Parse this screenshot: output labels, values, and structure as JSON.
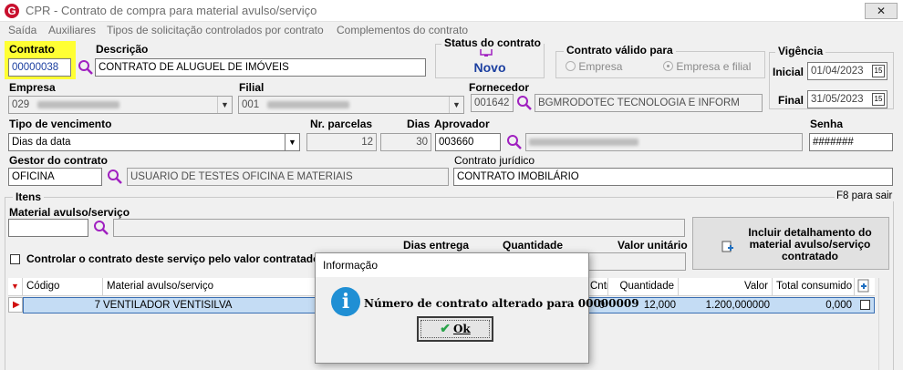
{
  "window": {
    "title": "CPR - Contrato de compra para material avulso/serviço",
    "close_label": "✕"
  },
  "menu": {
    "items": [
      {
        "label": "Saída",
        "underline": "S"
      },
      {
        "label": "Auxiliares",
        "underline": "A"
      },
      {
        "label": "Tipos de solicitação controlados por contrato",
        "underline": "T"
      },
      {
        "label": "Complementos do contrato",
        "underline": "C"
      }
    ]
  },
  "form": {
    "contrato_label": "Contrato",
    "contrato_value": "00000038",
    "descricao_label": "Descrição",
    "descricao_value": "CONTRATO DE ALUGUEL DE IMÓVEIS",
    "status_title": "Status do contrato",
    "status_value": "Novo",
    "valido_title": "Contrato válido para",
    "valido_empresa": "Empresa",
    "valido_filial": "Empresa e filial",
    "vigencia_title": "Vigência",
    "inicial_label": "Inicial",
    "inicial_value": "01/04/2023",
    "final_label": "Final",
    "final_value": "31/05/2023",
    "empresa_label": "Empresa",
    "empresa_code": "029",
    "filial_label": "Filial",
    "filial_code": "001",
    "fornecedor_label": "Fornecedor",
    "fornecedor_code": "001642",
    "fornecedor_name": "BGMRODOTEC TECNOLOGIA E INFORM",
    "tipo_venc_label": "Tipo de vencimento",
    "tipo_venc_value": "Dias da data",
    "nr_parcelas_label": "Nr. parcelas",
    "nr_parcelas_value": "12",
    "dias_label": "Dias",
    "dias_value": "30",
    "aprovador_label": "Aprovador",
    "aprovador_code": "003660",
    "senha_label": "Senha",
    "senha_value": "#######",
    "gestor_label": "Gestor do contrato",
    "gestor_code": "OFICINA",
    "gestor_name": "USUARIO DE TESTES OFICINA E MATERIAIS",
    "juridico_label": "Contrato jurídico",
    "juridico_value": "CONTRATO IMOBILÁRIO"
  },
  "itens": {
    "title": "Itens",
    "hint": "F8 para sair",
    "material_label": "Material avulso/serviço",
    "material_code": "",
    "controlar_label": "Controlar o contrato deste serviço pelo valor contratado",
    "dias_entrega_label": "Dias entrega",
    "quantidade_label": "Quantidade",
    "valor_unit_label": "Valor unitário",
    "incluir_label": "Incluir detalhamento do material avulso/serviço contratado",
    "columns": [
      "Código",
      "Material avulso/serviço",
      "Cntr.",
      "Quantidade",
      "Valor",
      "Total consumido"
    ],
    "rows": [
      {
        "codigo": "7",
        "material": "VENTILADOR VENTISILVA",
        "cntr": "0",
        "quantidade": "12,000",
        "valor": "1.200,000000",
        "total": "0,000"
      }
    ]
  },
  "dialog": {
    "title": "Informação",
    "message": "Número de contrato alterado para 00000009",
    "ok_label": "Ok"
  },
  "colors": {
    "highlight_yellow": "#ffff33",
    "accent_purple": "#a020c0",
    "status_blue": "#1b3fa0",
    "row_selected": "#c4dcf4",
    "info_blue": "#1f8fd4"
  }
}
